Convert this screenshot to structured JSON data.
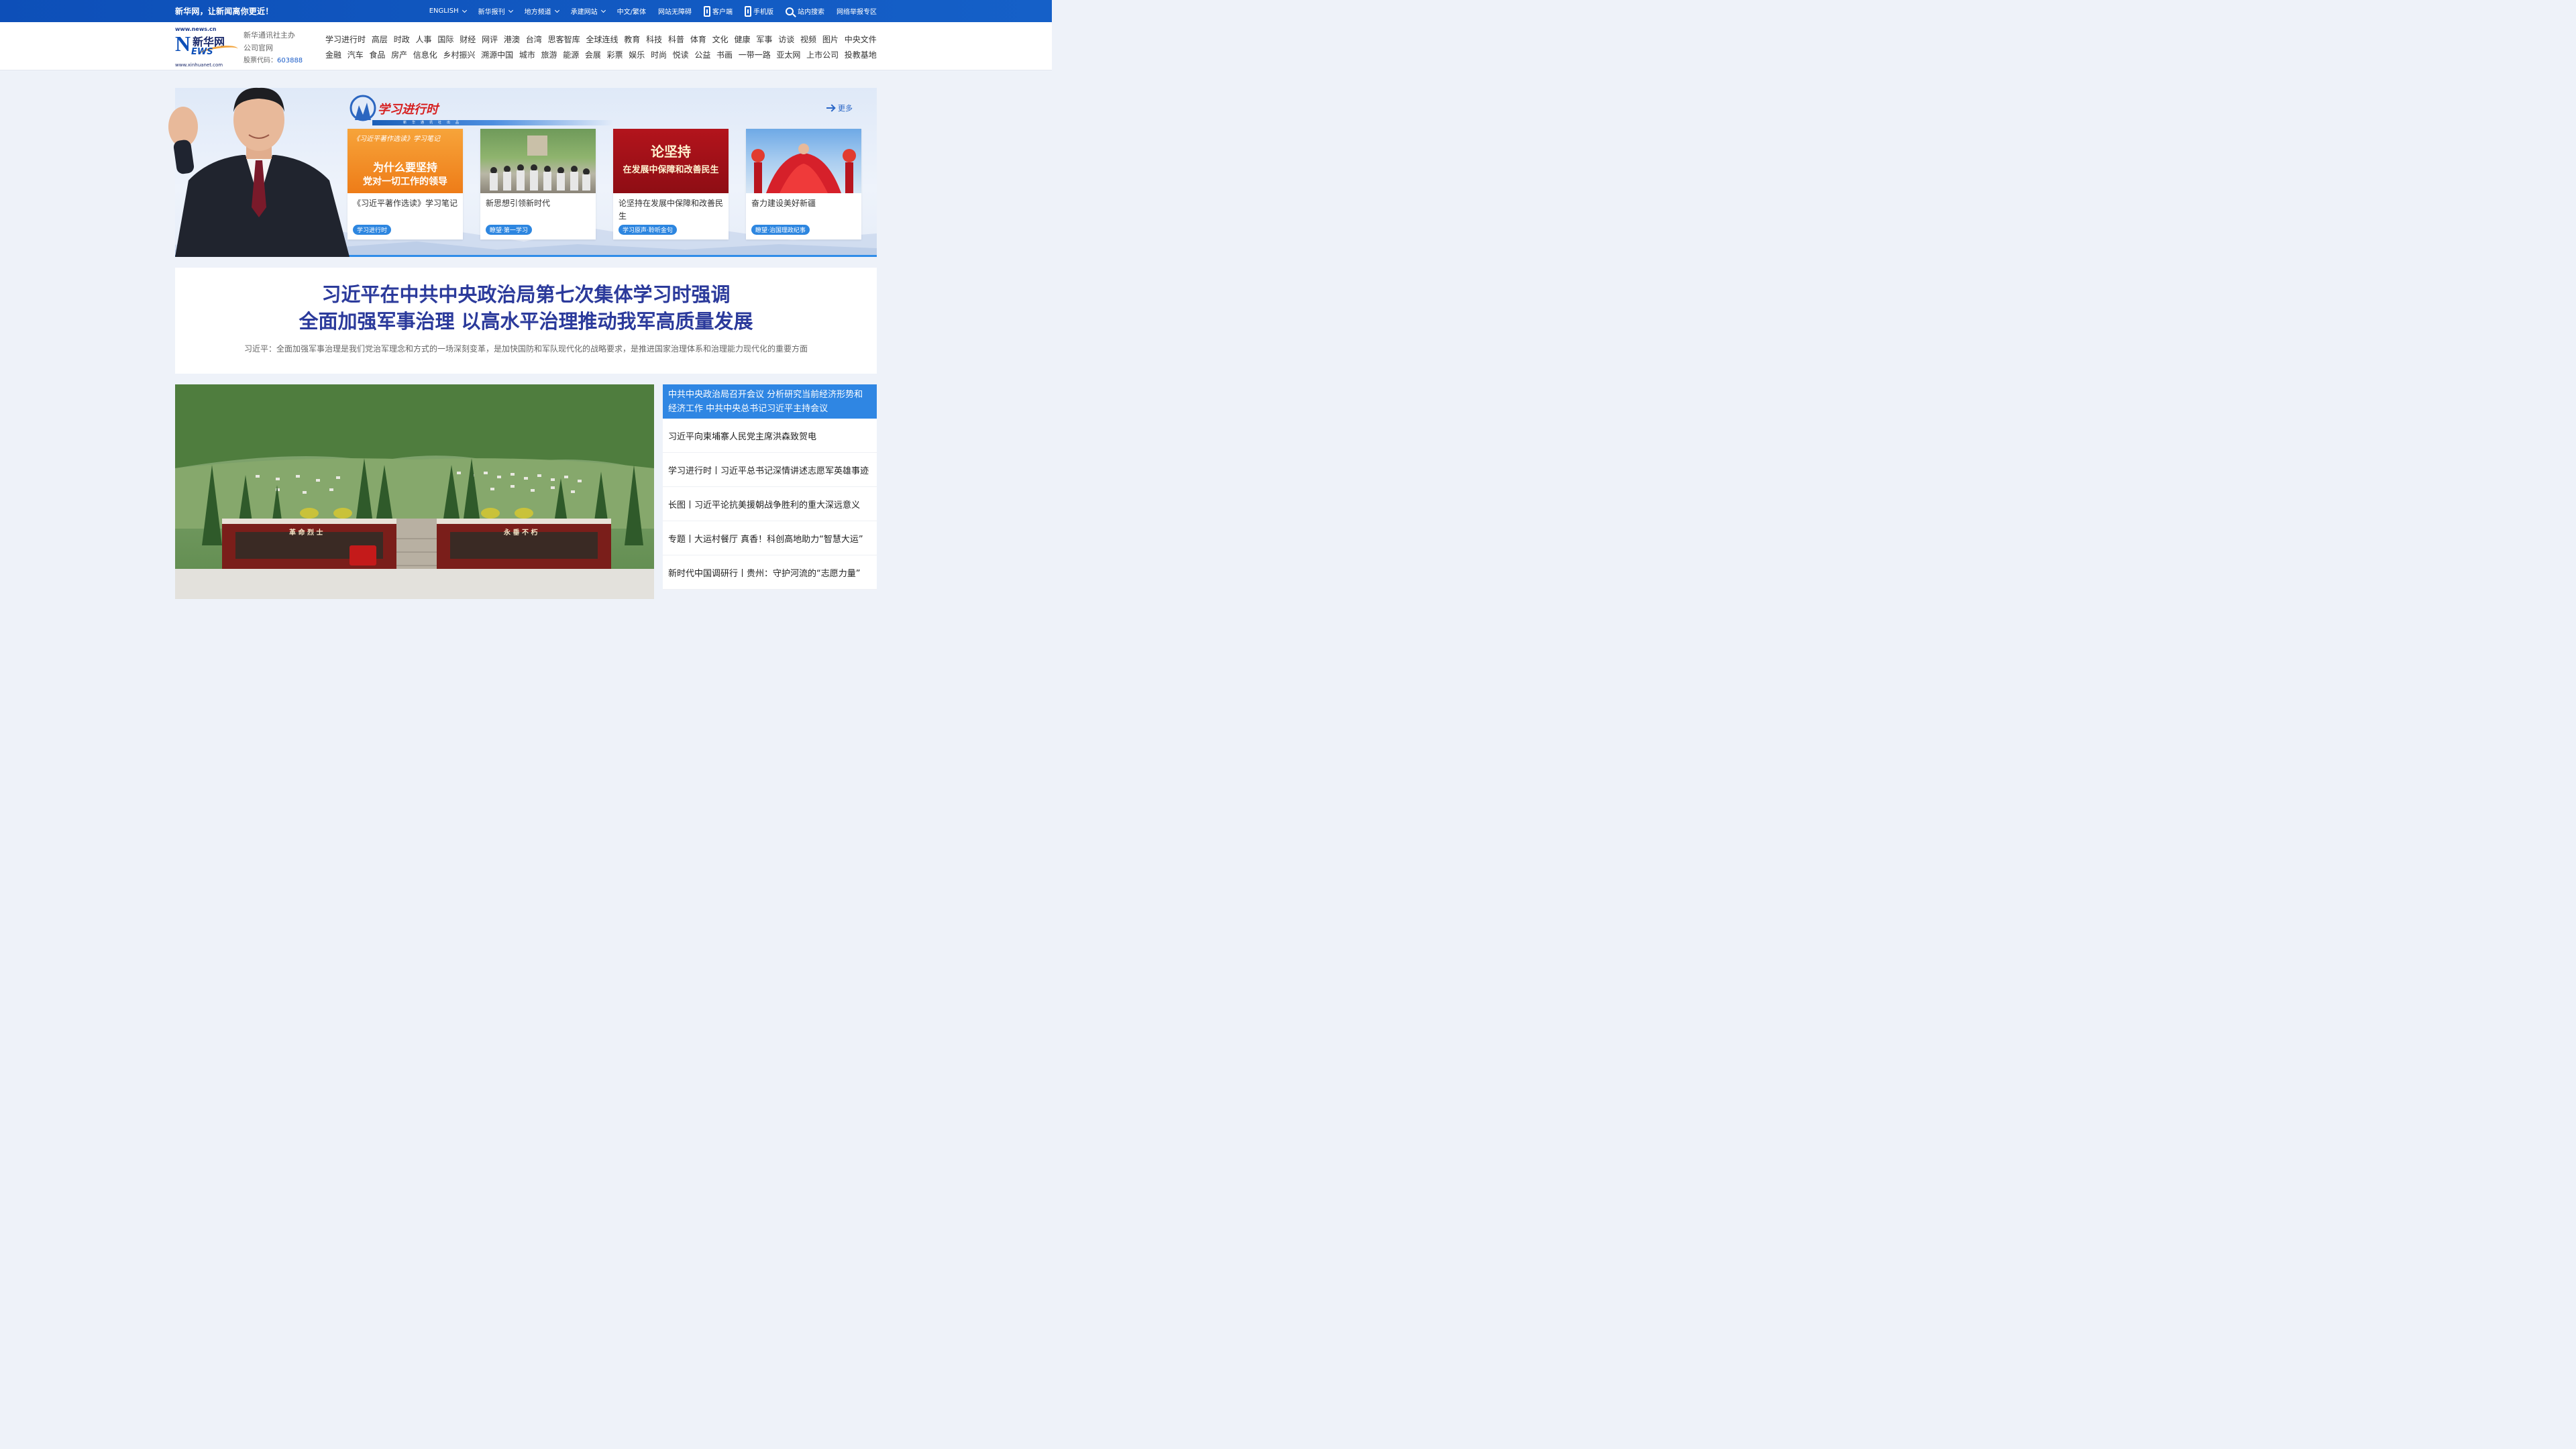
{
  "topbar": {
    "slogan": "新华网，让新闻离你更近！",
    "nav": [
      {
        "label": "ENGLISH",
        "has_dropdown": true
      },
      {
        "label": "新华报刊",
        "has_dropdown": true
      },
      {
        "label": "地方频道",
        "has_dropdown": true
      },
      {
        "label": "承建网站",
        "has_dropdown": true
      },
      {
        "label": "中文/繁体",
        "has_dropdown": false
      },
      {
        "label": "网站无障碍",
        "has_dropdown": false
      },
      {
        "label": "客户端",
        "icon": "phone-icon"
      },
      {
        "label": "手机版",
        "icon": "phone-icon"
      },
      {
        "label": "站内搜索",
        "icon": "search-icon"
      },
      {
        "label": "网络举报专区"
      }
    ]
  },
  "logo": {
    "url_text": "www.news.cn",
    "cn_text": "新华网",
    "n_text": "N",
    "ews_text": "EWS",
    "bottom_text": "www.xinhuanet.com"
  },
  "company": {
    "line1": "新华通讯社主办",
    "line2": "公司官网",
    "stock_label": "股票代码：",
    "stock_code": "603888"
  },
  "mainnav": {
    "row1": [
      "学习进行时",
      "高层",
      "时政",
      "人事",
      "国际",
      "财经",
      "网评",
      "港澳",
      "台湾",
      "思客智库",
      "全球连线",
      "教育",
      "科技",
      "科普",
      "体育",
      "文化",
      "健康",
      "军事",
      "访谈",
      "视频",
      "图片",
      "中央文件"
    ],
    "row2": [
      "金融",
      "汽车",
      "食品",
      "房产",
      "信息化",
      "乡村振兴",
      "溯源中国",
      "城市",
      "旅游",
      "能源",
      "会展",
      "彩票",
      "娱乐",
      "时尚",
      "悦读",
      "公益",
      "书画",
      "一带一路",
      "亚太网",
      "上市公司",
      "投教基地"
    ]
  },
  "banner": {
    "section_title": "学习进行时",
    "section_sub": "新华通讯社出品",
    "more_label": "更多",
    "cards": [
      {
        "title": "《习近平著作选读》学习笔记",
        "tag": "学习进行时",
        "img_line1": "《习近平著作选读》学习笔记",
        "img_line2": "为什么要坚持",
        "img_line3": "党对一切工作的领导"
      },
      {
        "title": "新思想引领新时代",
        "tag": "瞭望·第一学习"
      },
      {
        "title": "论坚持在发展中保障和改善民生",
        "tag": "学习原声·聆听金句",
        "img_line1": "论坚持",
        "img_line2": "在发展中保障和改善民生"
      },
      {
        "title": "奋力建设美好新疆",
        "tag": "瞭望·治国理政纪事"
      }
    ]
  },
  "headline": {
    "line1": "习近平在中共中央政治局第七次集体学习时强调",
    "line2": "全面加强军事治理 以高水平治理推动我军高质量发展",
    "summary": "习近平：全面加强军事治理是我们党治军理念和方式的一场深刻变革，是加快国防和军队现代化的战略要求，是推进国家治理体系和治理能力现代化的重要方面"
  },
  "photo": {
    "sign_left": "革 命 烈 士",
    "sign_right": "永 垂 不 朽"
  },
  "news_list": {
    "featured": "中共中央政治局召开会议 分析研究当前经济形势和经济工作 中共中央总书记习近平主持会议",
    "items": [
      "习近平向柬埔寨人民党主席洪森致贺电",
      "学习进行时丨习近平总书记深情讲述志愿军英雄事迹",
      "长图丨习近平论抗美援朝战争胜利的重大深远意义",
      "专题丨大运村餐厅 真香！科创高地助力“智慧大运”",
      "新时代中国调研行丨贵州：守护河流的“志愿力量”"
    ]
  },
  "colors": {
    "topbar": "#0d4fb8",
    "headline": "#2b3a9b",
    "accent": "#2f86e3",
    "tag": "#2d86e0"
  }
}
